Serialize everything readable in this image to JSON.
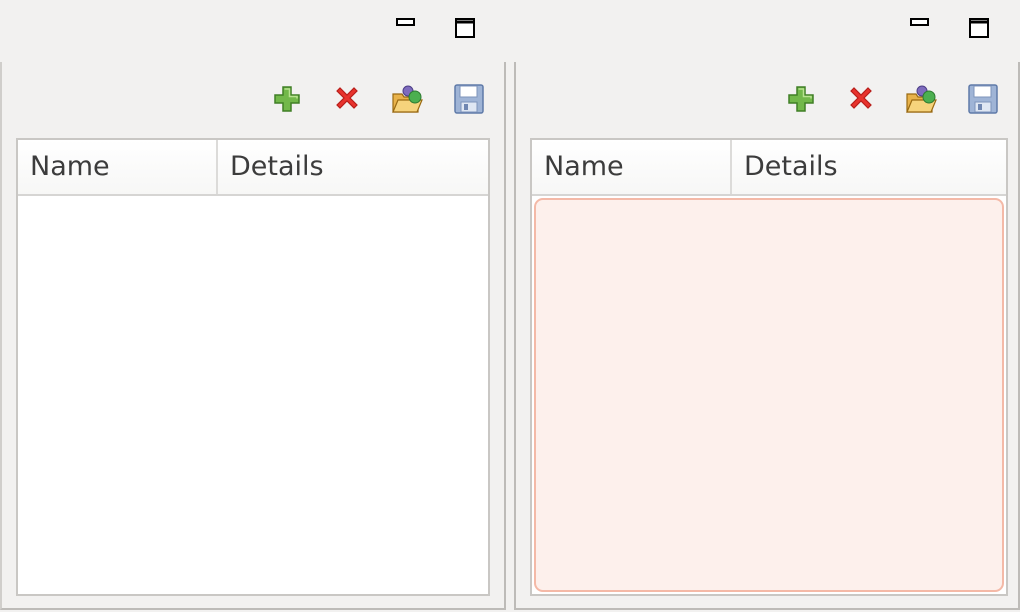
{
  "left_pane": {
    "window_controls": {
      "minimize": "minimize-icon",
      "maximize": "maximize-icon"
    },
    "toolbar": [
      "add-icon",
      "remove-icon",
      "open-icon",
      "save-icon"
    ],
    "table": {
      "columns": [
        "Name",
        "Details"
      ],
      "rows": []
    }
  },
  "right_pane": {
    "window_controls": {
      "minimize": "minimize-icon",
      "maximize": "maximize-icon"
    },
    "toolbar": [
      "add-icon",
      "remove-icon",
      "open-icon",
      "save-icon"
    ],
    "table": {
      "columns": [
        "Name",
        "Details"
      ],
      "rows": [],
      "state": "highlighted"
    }
  },
  "colors": {
    "background": "#f2f1f0",
    "highlight_fill": "#fdf0ec",
    "highlight_border": "#f4b9a7",
    "add_green": "#5fa33b",
    "remove_red": "#e0302c"
  }
}
